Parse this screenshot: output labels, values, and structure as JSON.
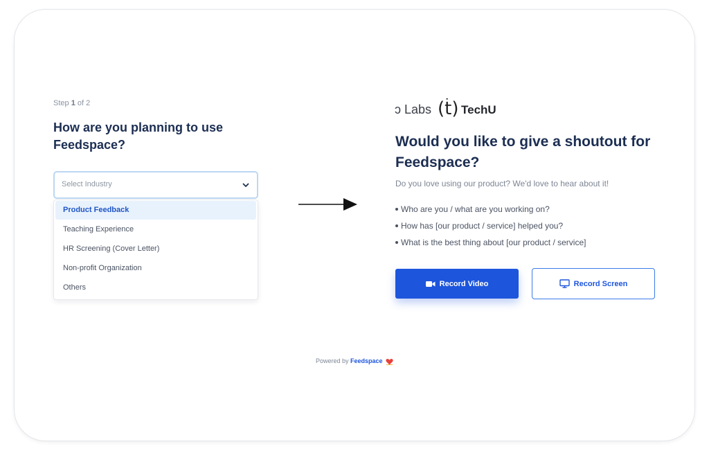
{
  "step": {
    "prefix": "Step",
    "current": "1",
    "suffix": "of 2"
  },
  "question": {
    "title": "How are you planning to use Feedspace?"
  },
  "industry_select": {
    "placeholder": "Select Industry",
    "options": [
      {
        "label": "Product Feedback",
        "selected": true
      },
      {
        "label": "Teaching Experience",
        "selected": false
      },
      {
        "label": "HR Screening (Cover Letter)",
        "selected": false
      },
      {
        "label": "Non-profit Organization",
        "selected": false
      },
      {
        "label": "Others",
        "selected": false
      }
    ]
  },
  "preview": {
    "logos": {
      "left": "ɔ Labs",
      "mark": "(ṫ)",
      "right": "TechU"
    },
    "title": "Would you like to give a shoutout for Feedspace?",
    "subtitle": "Do you love using our product? We'd love to hear about it!",
    "prompts": [
      "Who are you / what are you working on?",
      "How has [our product / service] helped you?",
      "What is the best thing about [our product / service]"
    ],
    "buttons": {
      "record_video": "Record Video",
      "record_screen": "Record Screen"
    }
  },
  "footer": {
    "powered_by": "Powered by",
    "brand": "Feedspace"
  },
  "icons": {
    "chevron": "chevron-down-icon",
    "arrow": "arrow-right-icon",
    "video": "video-camera-icon",
    "screen": "monitor-icon",
    "heart": "heart-icon"
  },
  "colors": {
    "primary": "#1d55dc",
    "title": "#1c2e52",
    "heart": "#e8413c"
  }
}
